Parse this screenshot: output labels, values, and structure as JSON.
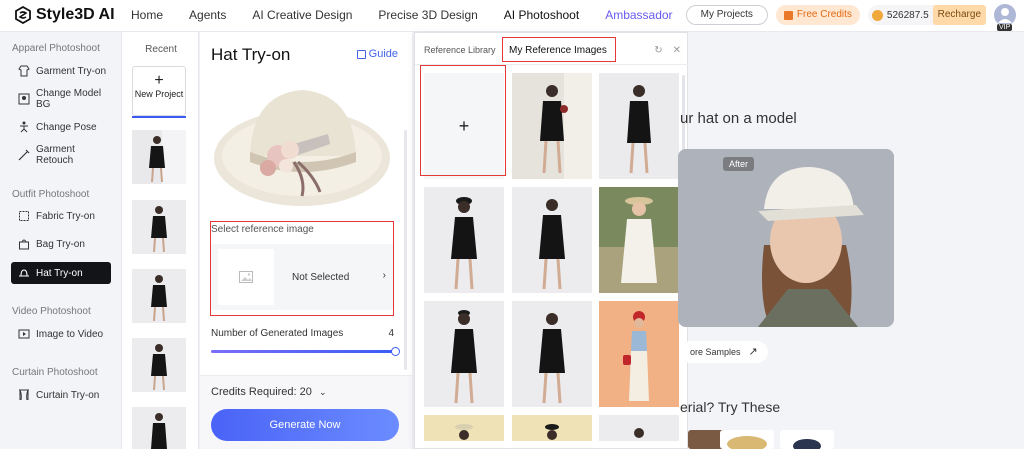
{
  "app": {
    "name": "Style3D AI"
  },
  "nav": {
    "items": [
      "Home",
      "Agents",
      "AI Creative Design",
      "Precise 3D Design",
      "AI Photoshoot",
      "Ambassador"
    ],
    "my_projects": "My Projects",
    "free_credits": "Free Credits",
    "balance": "526287.5",
    "recharge": "Recharge",
    "vip": "VIP"
  },
  "sidebar": {
    "sections": [
      {
        "title": "Apparel Photoshoot",
        "items": [
          "Garment Try-on",
          "Change Model BG",
          "Change Pose",
          "Garment Retouch"
        ]
      },
      {
        "title": "Outfit Photoshoot",
        "items": [
          "Fabric Try-on",
          "Bag Try-on",
          "Hat Try-on"
        ]
      },
      {
        "title": "Video Photoshoot",
        "items": [
          "Image to Video"
        ]
      },
      {
        "title": "Curtain Photoshoot",
        "items": [
          "Curtain Try-on"
        ]
      }
    ],
    "active": "Hat Try-on"
  },
  "recent": {
    "title": "Recent",
    "new_project": "New Project"
  },
  "panel": {
    "title": "Hat Try-on",
    "guide": "Guide",
    "select_label": "Select reference image",
    "select_value": "Not Selected",
    "num_label": "Number of Generated Images",
    "num_value": "4",
    "num_fraction": 1.0,
    "credits": "Credits Required: 20",
    "generate": "Generate Now"
  },
  "ref_popup": {
    "tabs": [
      "Reference Library",
      "My Reference Images"
    ],
    "active_tab": "My Reference Images",
    "add_symbol": "+"
  },
  "main": {
    "heading": "ur hat on a model",
    "after_badge": "After",
    "more_samples": "ore Samples",
    "try_these": "erial? Try These"
  },
  "colors": {
    "accent": "#3a5cf5",
    "nav_accent": "#6a5bf2",
    "highlight": "#e43838",
    "active_sidebar": "#131418"
  }
}
